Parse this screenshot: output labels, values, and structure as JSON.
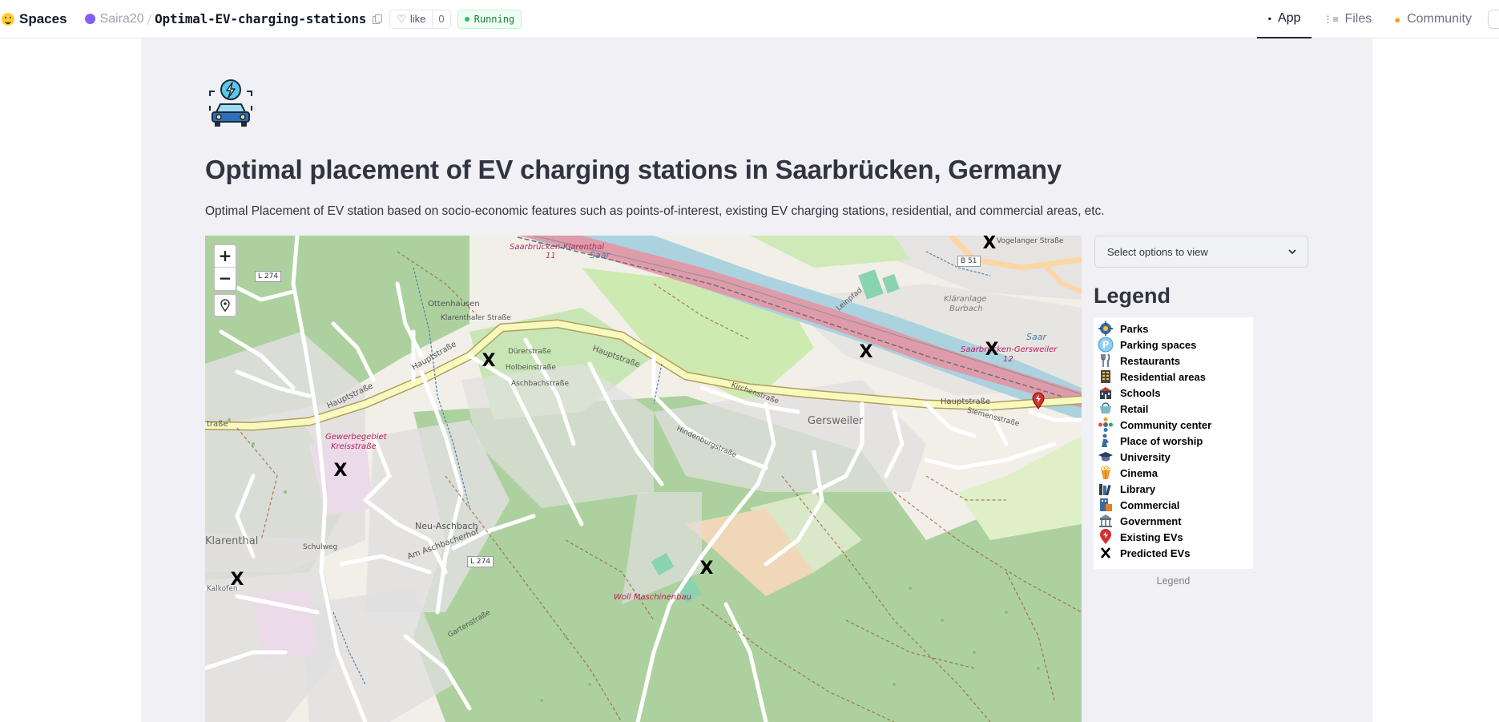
{
  "nav": {
    "brand": "Spaces",
    "owner": "Saira20",
    "separator": "/",
    "repo": "Optimal-EV-charging-stations",
    "like_label": "like",
    "like_count": "0",
    "status": "Running",
    "tabs": [
      {
        "label": "App",
        "icon": "app-icon"
      },
      {
        "label": "Files",
        "icon": "files-icon"
      },
      {
        "label": "Community",
        "icon": "community-icon"
      }
    ]
  },
  "page": {
    "title": "Optimal placement of EV charging stations in Saarbrücken, Germany",
    "description": "Optimal Placement of EV station based on socio-economic features such as points-of-interest, existing EV charging stations, residential, and commercial areas, etc."
  },
  "map": {
    "zoom_in": "+",
    "zoom_out": "−",
    "labels": {
      "saarbruecken_klarenthal": "Saarbrücken-Klarenthal",
      "klarenthal_track": "11",
      "saar_1": "Saar",
      "saar_2": "Saar",
      "ottenhausen": "Ottenhausen",
      "klaerenthaler_strasse": "Klarenthaler Straße",
      "hauptstrasse_1": "Hauptstraße",
      "hauptstrasse_2": "Hauptstraße",
      "hauptstrasse_3": "Hauptstraße",
      "hauptstrasse_4": "Hauptstraße",
      "hauptstrasse_west": "traße",
      "durerstrasse": "Dürerstraße",
      "holbeinstrasse": "Holbeinstraße",
      "aschbachstrasse": "Aschbachstraße",
      "gewerbegebiet": "Gewerbegebiet",
      "kreisstrasse_area": "Kreisstraße",
      "gersweiler": "Gersweiler",
      "saarbruecken_gersweiler": "Saarbrücken-Gersweiler",
      "gersweiler_track": "12",
      "klaeranlage": "Kläranlage",
      "burbach": "Burbach",
      "neu_aschbach": "Neu-Aschbach",
      "am_aschbacherhof": "Am Aschbacherhof",
      "klarenthal": "Klarenthal",
      "woll_maschinenbau": "Woll Maschinenbau",
      "kirchenstrasse": "Kirchenstraße",
      "hindenburgstrasse": "Hindenburgstraße",
      "leinpfad": "Leinpfad",
      "siemensstrasse": "Siemensstraße",
      "schulweg": "Schulweg",
      "kalkofen": "Kalkofen",
      "gartenstrasse": "Gartenstraße",
      "vogelanger_strasse": "Vogelanger Straße"
    },
    "road_shields": [
      "L 274",
      "L 274",
      "B 51"
    ],
    "predicted_marker": "X",
    "existing_marker_icon": "red-ev-pin-icon"
  },
  "sidebar": {
    "select_placeholder": "Select options to view",
    "legend_title": "Legend",
    "legend_caption": "Legend",
    "legend_items": [
      {
        "label": "Parks",
        "icon": "park-icon"
      },
      {
        "label": "Parking spaces",
        "icon": "parking-icon"
      },
      {
        "label": "Restaurants",
        "icon": "cutlery-icon"
      },
      {
        "label": "Residential areas",
        "icon": "apartment-icon"
      },
      {
        "label": "Schools",
        "icon": "school-icon"
      },
      {
        "label": "Retail",
        "icon": "shop-icon"
      },
      {
        "label": "Community center",
        "icon": "community-center-icon"
      },
      {
        "label": "Place of worship",
        "icon": "worship-icon"
      },
      {
        "label": "University",
        "icon": "graduation-cap-icon"
      },
      {
        "label": "Cinema",
        "icon": "popcorn-icon"
      },
      {
        "label": "Library",
        "icon": "books-icon"
      },
      {
        "label": "Commercial",
        "icon": "commercial-icon"
      },
      {
        "label": "Government",
        "icon": "government-icon"
      },
      {
        "label": "Existing EVs",
        "icon": "red-ev-pin-icon"
      },
      {
        "label": "Predicted EVs",
        "icon": "x-mark-icon"
      }
    ]
  },
  "colors": {
    "accent_running": "#15803d",
    "map_land": "#f2efe9",
    "map_forest": "#add19e",
    "map_water": "#aad3df",
    "map_rail": "#e892a2",
    "map_primary_road": "#f7fabf",
    "existing_ev_pin": "#d32f2f"
  }
}
